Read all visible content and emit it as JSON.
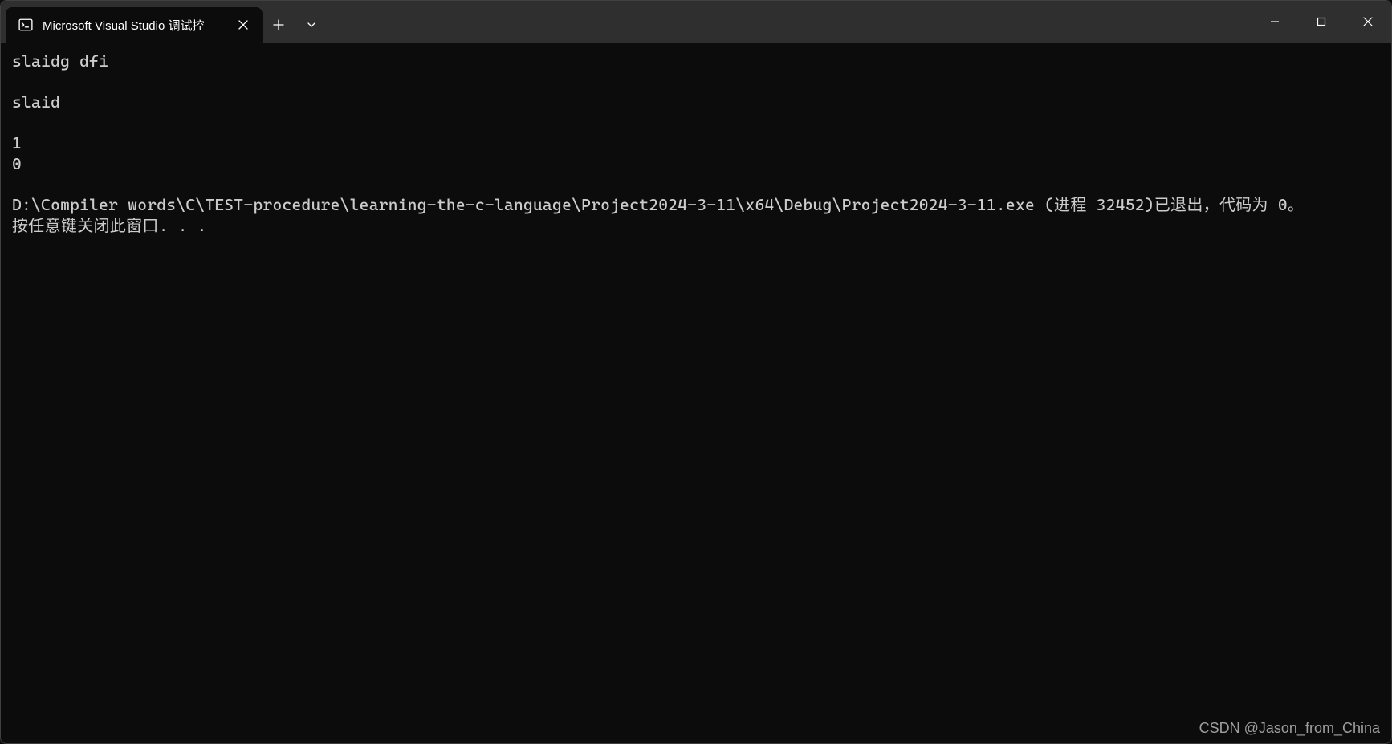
{
  "tab": {
    "title": "Microsoft Visual Studio 调试控"
  },
  "console": {
    "lines": "slaidg dfi\n\nslaid\n\n1\n0\n\nD:\\Compiler words\\C\\TEST-procedure\\learning-the-c-language\\Project2024-3-11\\x64\\Debug\\Project2024-3-11.exe (进程 32452)已退出，代码为 0。\n按任意键关闭此窗口. . ."
  },
  "watermark": "CSDN @Jason_from_China"
}
